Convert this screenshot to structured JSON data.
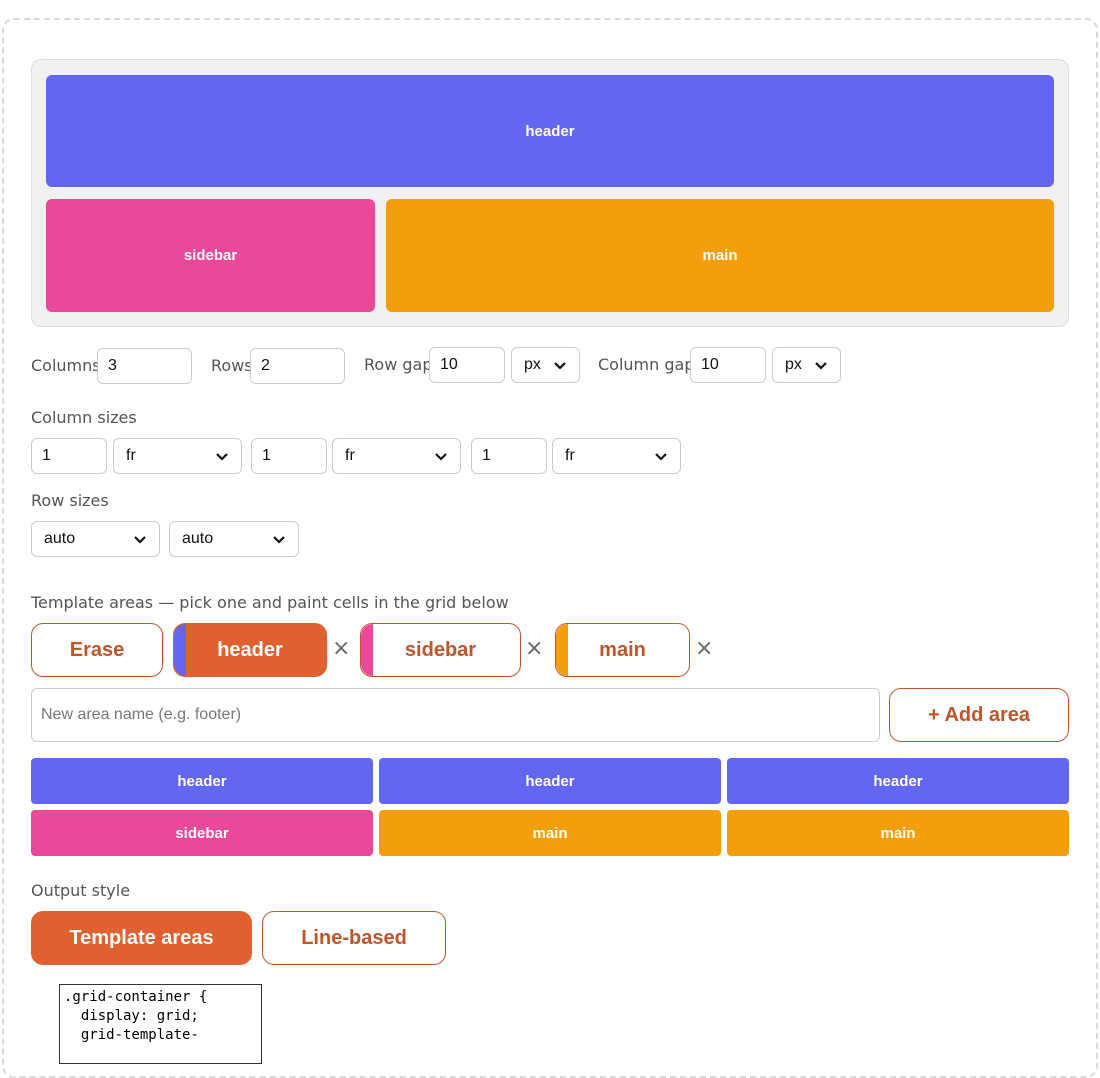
{
  "colors": {
    "header": "#6366f1",
    "sidebar": "#ec4899",
    "main": "#f59e0b",
    "accent": "#e0612f"
  },
  "preview": {
    "header": "header",
    "sidebar": "sidebar",
    "main": "main"
  },
  "controls": {
    "columns_label": "Columns",
    "columns_value": "3",
    "rows_label": "Rows",
    "rows_value": "2",
    "row_gap_label": "Row gap",
    "row_gap_value": "10",
    "row_gap_unit": "px",
    "column_gap_label": "Column gap",
    "column_gap_value": "10",
    "column_gap_unit": "px"
  },
  "column_sizes": {
    "label": "Column sizes",
    "items": [
      {
        "value": "1",
        "unit": "fr"
      },
      {
        "value": "1",
        "unit": "fr"
      },
      {
        "value": "1",
        "unit": "fr"
      }
    ]
  },
  "row_sizes": {
    "label": "Row sizes",
    "items": [
      "auto",
      "auto"
    ]
  },
  "areas": {
    "label": "Template areas — pick one and paint cells in the grid below",
    "erase_label": "Erase",
    "chips": [
      {
        "name": "header",
        "remove": "×"
      },
      {
        "name": "sidebar",
        "remove": "×"
      },
      {
        "name": "main",
        "remove": "×"
      }
    ],
    "new_area_placeholder": "New area name (e.g. footer)",
    "add_label": "+ Add area"
  },
  "area_grid": [
    [
      "header",
      "header",
      "header"
    ],
    [
      "sidebar",
      "main",
      "main"
    ]
  ],
  "output": {
    "label": "Output style",
    "template_label": "Template areas",
    "line_label": "Line-based",
    "code": ".grid-container {\n  display: grid;\n  grid-template-"
  }
}
